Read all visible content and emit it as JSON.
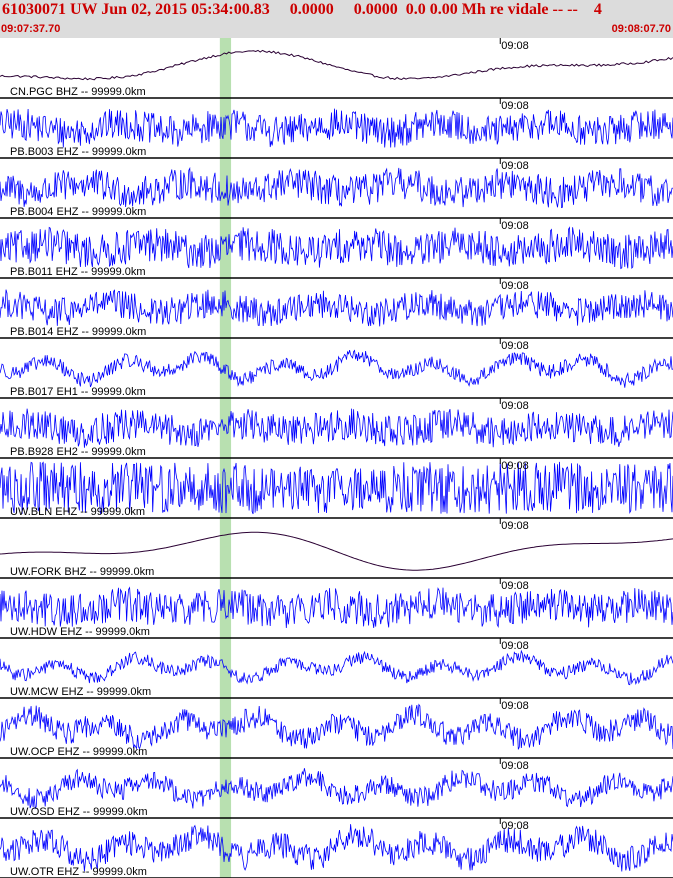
{
  "header": {
    "title": "61030071 UW Jun 02, 2015 05:34:00.83     0.0000     0.0000  0.0 0.00 Mh re vidale -- --    4",
    "time_start": "09:07:37.70",
    "time_end": "09:08:07.70"
  },
  "colors": {
    "header_bg": "#dcdcdc",
    "header_text": "#cc0000",
    "trace_blue": "#0000ff",
    "trace_dark": "#2a0033",
    "pick_marker": "#b8e0b0",
    "separator": "#000000"
  },
  "chart_data": {
    "type": "line",
    "x_range_seconds": [
      0,
      30
    ],
    "tick_label": "09:08",
    "tick_time_s": 22.3,
    "pick_time_s": [
      9.8,
      10.3
    ],
    "traces": [
      {
        "label": "CN.PGC BHZ --  99999.0km",
        "color": "dark",
        "style": "smooth",
        "noise": 0.08,
        "amp": 0.7
      },
      {
        "label": "PB.B003 EHZ --  99999.0km",
        "color": "blue",
        "style": "noisy",
        "noise": 0.55,
        "amp": 0.4
      },
      {
        "label": "PB.B004 EHZ --  99999.0km",
        "color": "blue",
        "style": "noisy",
        "noise": 0.55,
        "amp": 0.45
      },
      {
        "label": "PB.B011 EHZ --  99999.0km",
        "color": "blue",
        "style": "noisy",
        "noise": 0.6,
        "amp": 0.4
      },
      {
        "label": "PB.B014 EHZ --  99999.0km",
        "color": "blue",
        "style": "noisy",
        "noise": 0.5,
        "amp": 0.45
      },
      {
        "label": "PB.B017 EH1 --  99999.0km",
        "color": "blue",
        "style": "wavy",
        "noise": 0.25,
        "amp": 0.55
      },
      {
        "label": "PB.B928 EH2 --  99999.0km",
        "color": "blue",
        "style": "noisy",
        "noise": 0.55,
        "amp": 0.4
      },
      {
        "label": "UW.BLN EHZ --  99999.0km",
        "color": "blue",
        "style": "saturated",
        "noise": 1.0,
        "amp": 0.9
      },
      {
        "label": "UW.FORK BHZ --  99999.0km",
        "color": "dark",
        "style": "smooth",
        "noise": 0.0,
        "amp": 0.85
      },
      {
        "label": "UW.HDW EHZ --  99999.0km",
        "color": "blue",
        "style": "noisy",
        "noise": 0.6,
        "amp": 0.35
      },
      {
        "label": "UW.MCW EHZ --  99999.0km",
        "color": "blue",
        "style": "wavy",
        "noise": 0.22,
        "amp": 0.5
      },
      {
        "label": "UW.OCP EHZ --  99999.0km",
        "color": "blue",
        "style": "wavy",
        "noise": 0.4,
        "amp": 0.55
      },
      {
        "label": "UW.OSD EHZ --  99999.0km",
        "color": "blue",
        "style": "wavy",
        "noise": 0.35,
        "amp": 0.5
      },
      {
        "label": "UW.OTR EHZ --  99999.0km",
        "color": "blue",
        "style": "wavy",
        "noise": 0.45,
        "amp": 0.55
      }
    ]
  }
}
